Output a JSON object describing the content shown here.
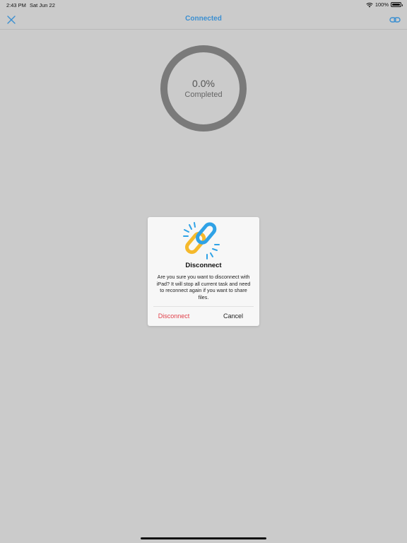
{
  "status_bar": {
    "time": "2:43 PM",
    "date": "Sat Jun 22",
    "battery": "100%"
  },
  "nav": {
    "title": "Connected",
    "close_icon": "close-icon",
    "link_icon": "link-icon"
  },
  "progress": {
    "value": "0.0%",
    "label": "Completed",
    "fraction": 0.0
  },
  "dialog": {
    "title": "Disconnect",
    "message": "Are you sure you want to disconnect with iPad? It will stop all current task and need to reconnect again if you want to share files.",
    "disconnect_label": "Disconnect",
    "cancel_label": "Cancel",
    "icon": "broken-chain-link-icon"
  },
  "colors": {
    "accent": "#3b8fd1",
    "destructive": "#e0404a",
    "ring": "#7a7a7a",
    "link_yellow": "#f5b92c",
    "link_blue": "#2fa2e6"
  }
}
